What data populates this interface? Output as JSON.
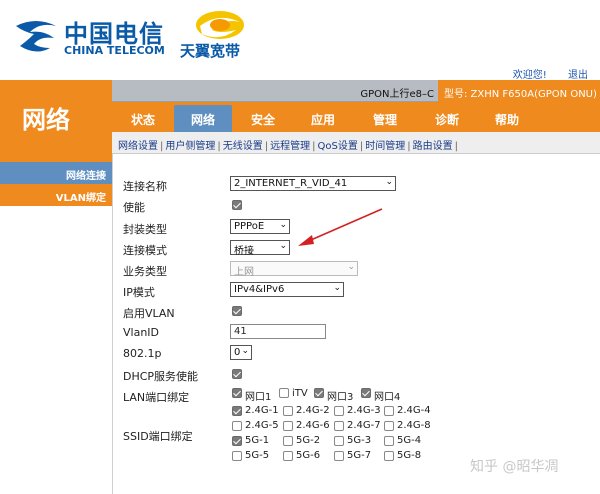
{
  "header": {
    "brand_cn": "中国电信",
    "brand_en": "CHINA TELECOM",
    "broadband_cn": "天翼宽带",
    "welcome_link": "欢迎您!",
    "logout_link": "退出"
  },
  "info_strip": {
    "gpon_label": "GPON上行e8–C",
    "model_label": "型号: ZXHN F650A(GPON ONU)"
  },
  "left_panel": {
    "title": "网络"
  },
  "main_nav": {
    "tabs": [
      {
        "label": "状态"
      },
      {
        "label": "网络",
        "active": true
      },
      {
        "label": "安全"
      },
      {
        "label": "应用"
      },
      {
        "label": "管理"
      },
      {
        "label": "诊断"
      },
      {
        "label": "帮助"
      }
    ]
  },
  "sub_nav": {
    "items": [
      "网络设置",
      "用户侧管理",
      "无线设置",
      "远程管理",
      "QoS设置",
      "时间管理",
      "路由设置"
    ]
  },
  "sidebar": {
    "items": [
      {
        "label": "网络连接"
      },
      {
        "label": "VLAN绑定"
      }
    ]
  },
  "form": {
    "conn_name_label": "连接名称",
    "conn_name_value": "2_INTERNET_R_VID_41",
    "enable_label": "使能",
    "encap_label": "封装类型",
    "encap_value": "PPPoE",
    "conn_mode_label": "连接模式",
    "conn_mode_value": "桥接",
    "service_label": "业务类型",
    "service_value": "上网",
    "ip_mode_label": "IP模式",
    "ip_mode_value": "IPv4&IPv6",
    "vlan_enable_label": "启用VLAN",
    "vlanid_label": "VlanID",
    "vlanid_value": "41",
    "p8021_label": "802.1p",
    "p8021_value": "0",
    "dhcp_label": "DHCP服务使能",
    "lan_bind_label": "LAN端口绑定",
    "lan_ports": [
      {
        "label": "网口1",
        "checked": true
      },
      {
        "label": "iTV",
        "checked": false
      },
      {
        "label": "网口3",
        "checked": true
      },
      {
        "label": "网口4",
        "checked": true
      }
    ],
    "ssid_bind_label": "SSID端口绑定",
    "ssid_ports": [
      {
        "label": "2.4G-1",
        "checked": true
      },
      {
        "label": "2.4G-2",
        "checked": false
      },
      {
        "label": "2.4G-3",
        "checked": false
      },
      {
        "label": "2.4G-4",
        "checked": false
      },
      {
        "label": "2.4G-5",
        "checked": false
      },
      {
        "label": "2.4G-6",
        "checked": false
      },
      {
        "label": "2.4G-7",
        "checked": false
      },
      {
        "label": "2.4G-8",
        "checked": false
      },
      {
        "label": "5G-1",
        "checked": true
      },
      {
        "label": "5G-2",
        "checked": false
      },
      {
        "label": "5G-3",
        "checked": false
      },
      {
        "label": "5G-4",
        "checked": false
      },
      {
        "label": "5G-5",
        "checked": false
      },
      {
        "label": "5G-6",
        "checked": false
      },
      {
        "label": "5G-7",
        "checked": false
      },
      {
        "label": "5G-8",
        "checked": false
      }
    ]
  },
  "watermark": "知乎 @昭华凋",
  "colors": {
    "orange": "#ef8a1e",
    "blue_tab": "#5f8fc0",
    "brand_blue": "#0a5aa8",
    "annotation_red": "#d42020"
  }
}
